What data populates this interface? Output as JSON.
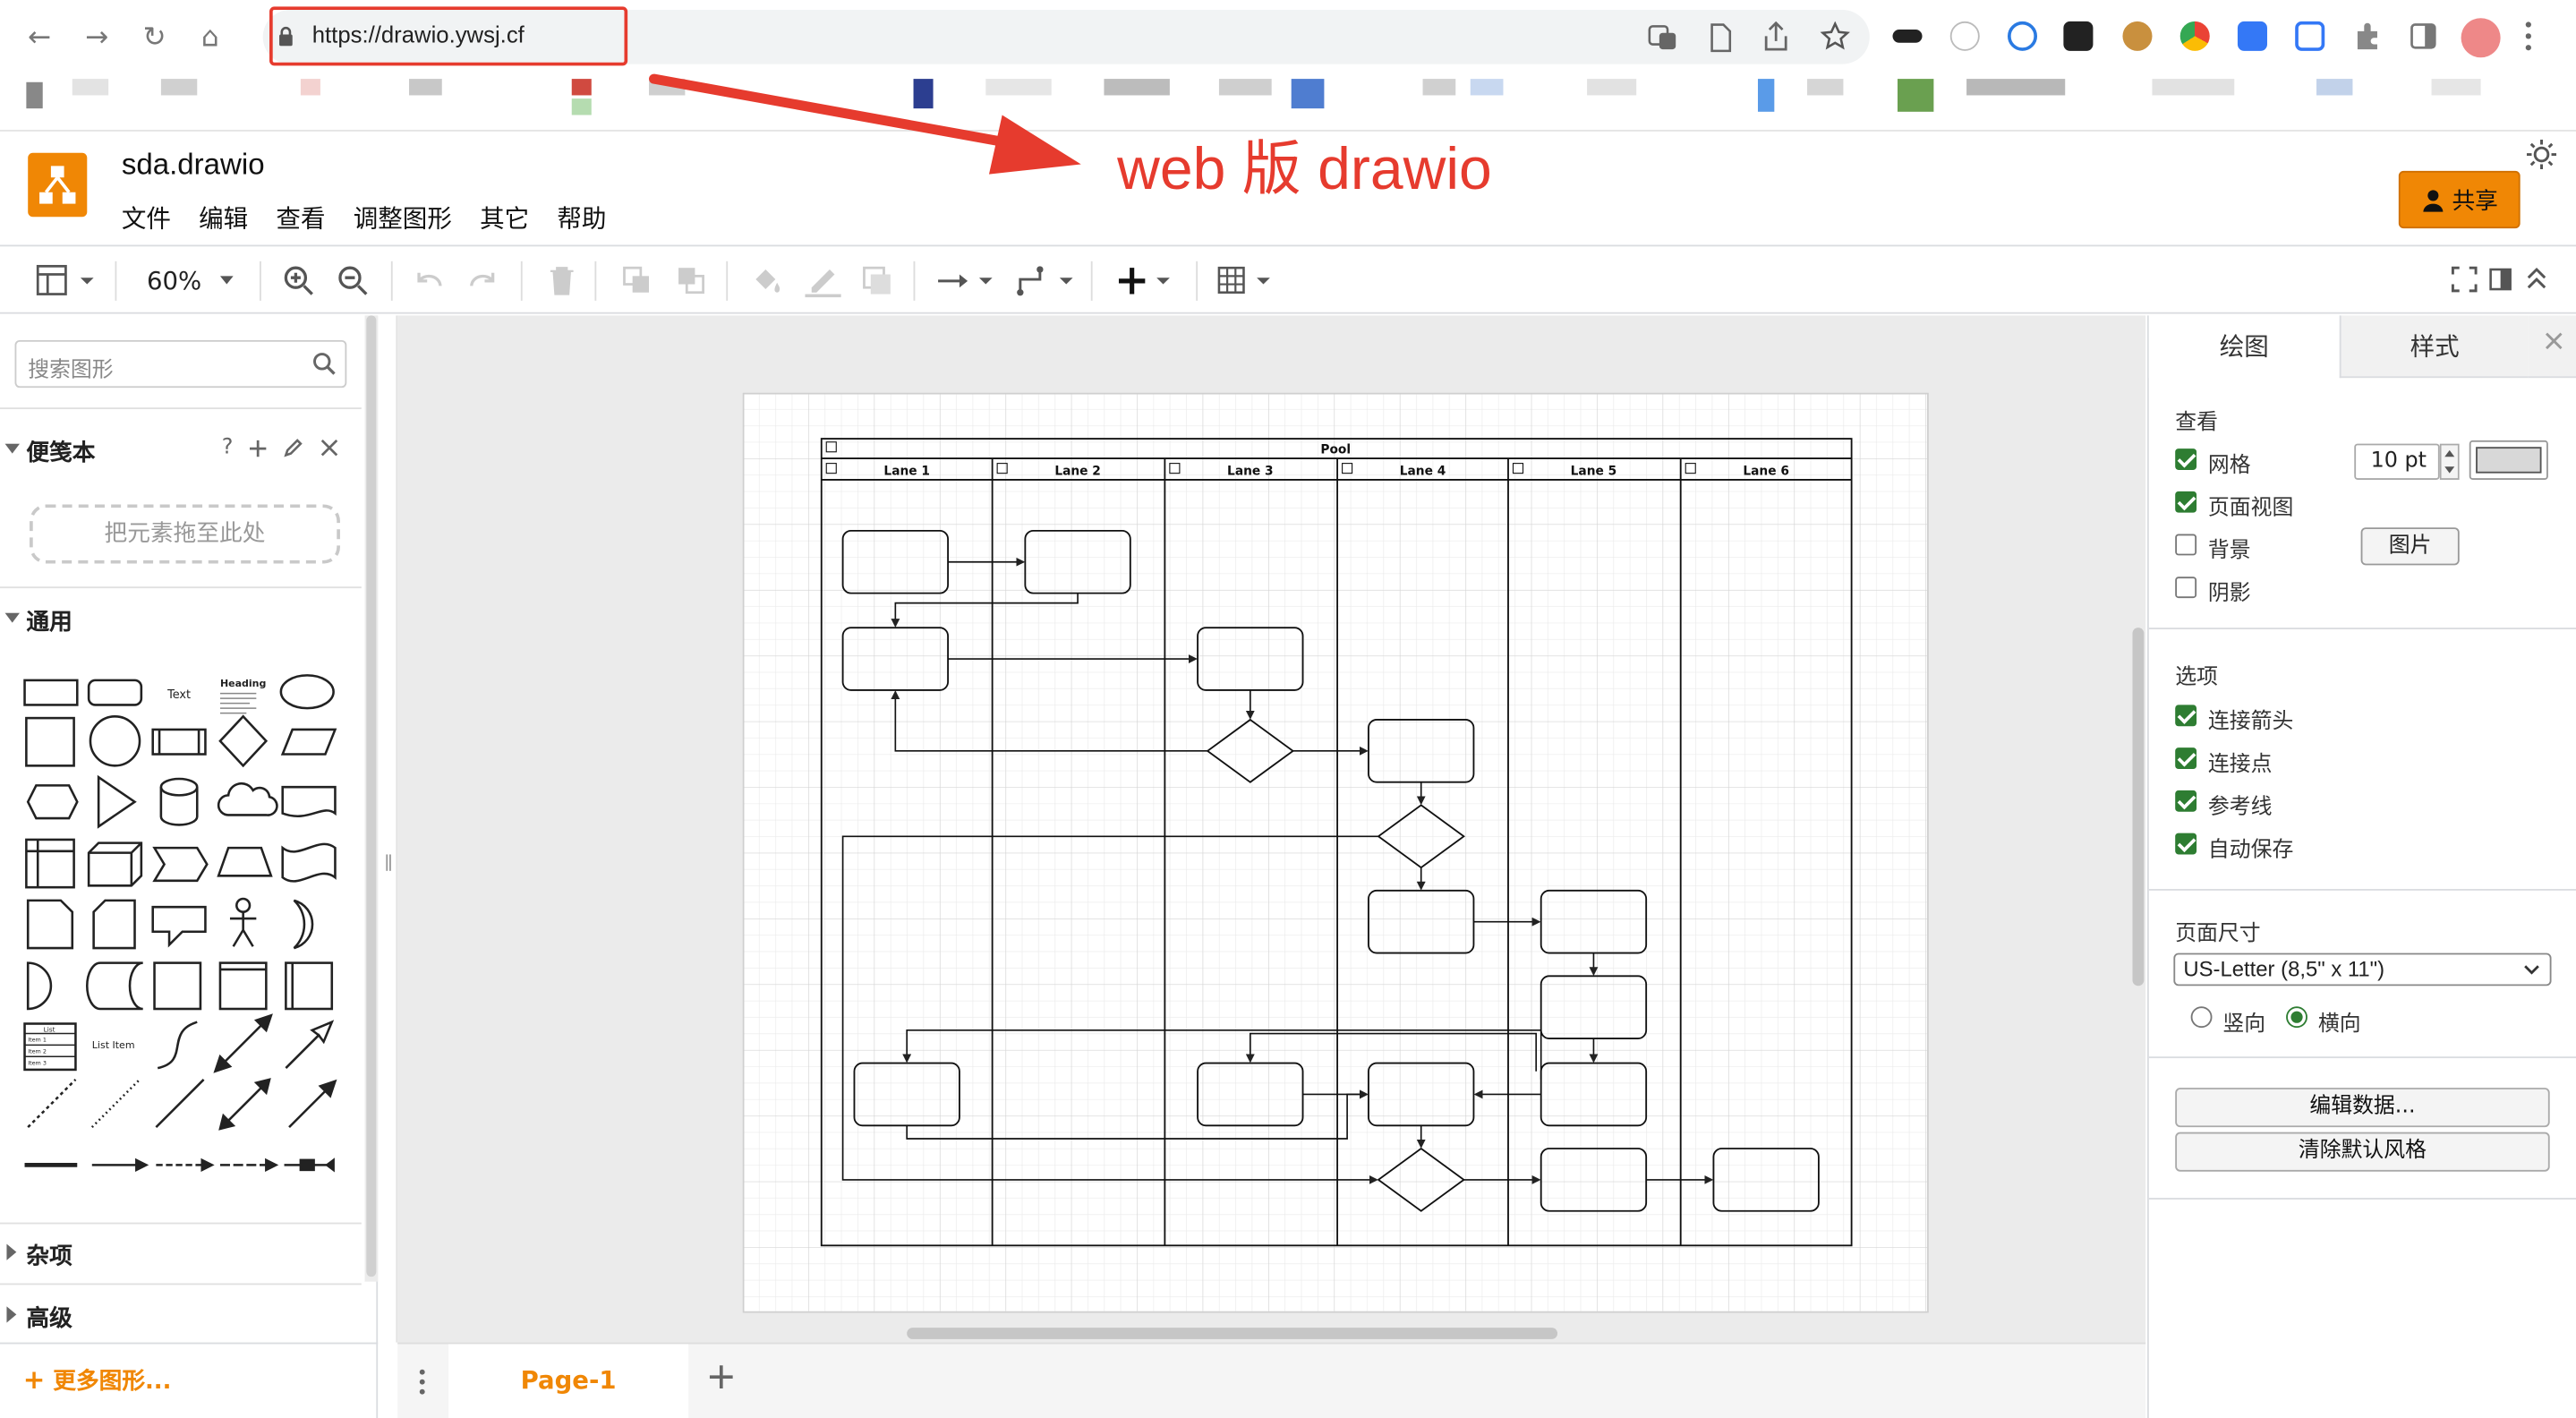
{
  "browser": {
    "url": "https://drawio.ywsj.cf"
  },
  "annotation": {
    "text": "web 版 drawio"
  },
  "app": {
    "title": "sda.drawio",
    "menu": [
      "文件",
      "编辑",
      "查看",
      "调整图形",
      "其它",
      "帮助"
    ],
    "share_label": "共享",
    "brand_color": "#f08705"
  },
  "toolbar": {
    "zoom": "60%"
  },
  "left_panel": {
    "search_placeholder": "搜索图形",
    "scratchpad_title": "便笺本",
    "scratchpad_help": "?",
    "scratchpad_drop": "把元素拖至此处",
    "general_title": "通用",
    "misc_title": "杂项",
    "advanced_title": "高级",
    "more_shapes": "更多图形...",
    "shape_labels": {
      "text": "Text",
      "heading": "Heading",
      "list": "List",
      "list_item": "List Item",
      "item1": "Item 1",
      "item2": "Item 2",
      "item3": "Item 3"
    }
  },
  "diagram": {
    "pool": "Pool",
    "lanes": [
      "Lane 1",
      "Lane 2",
      "Lane 3",
      "Lane 4",
      "Lane 5",
      "Lane 6"
    ]
  },
  "pages": {
    "current": "Page-1"
  },
  "right_panel": {
    "tabs": [
      "绘图",
      "样式"
    ],
    "view_title": "查看",
    "grid_label": "网格",
    "grid_size": "10 pt",
    "page_view_label": "页面视图",
    "background_label": "背景",
    "image_button": "图片",
    "shadow_label": "阴影",
    "options_title": "选项",
    "connection_arrows": "连接箭头",
    "connection_points": "连接点",
    "guides": "参考线",
    "autosave": "自动保存",
    "page_size_title": "页面尺寸",
    "page_size_value": "US-Letter (8,5\" x 11\")",
    "portrait": "竖向",
    "landscape": "横向",
    "edit_data": "编辑数据...",
    "clear_default_style": "清除默认风格",
    "checked_color": "#2e7d32"
  }
}
